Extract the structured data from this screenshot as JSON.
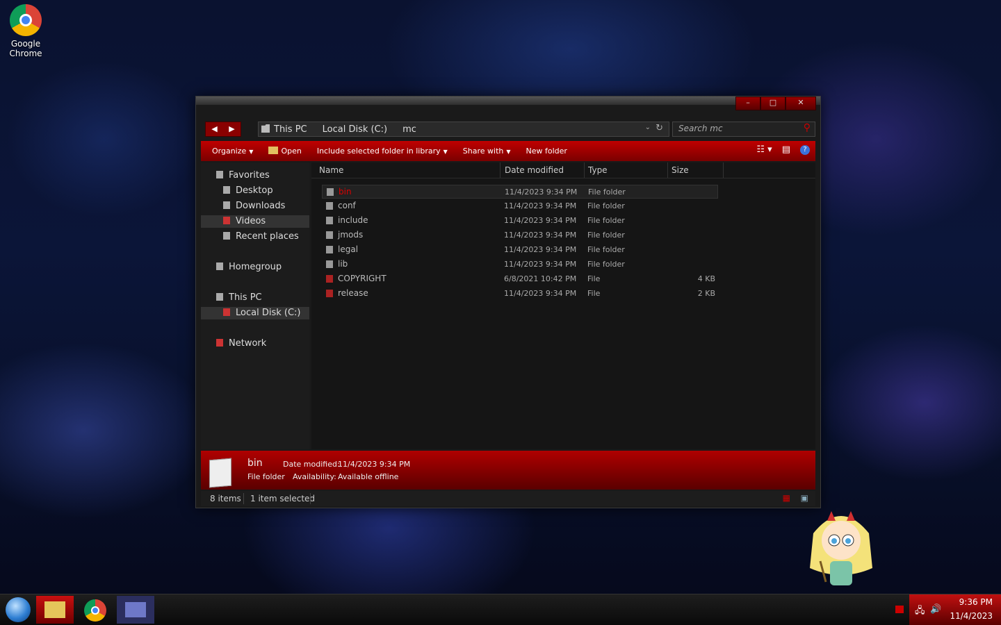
{
  "desktop": {
    "icon_label": "Google Chrome"
  },
  "window": {
    "controls": {
      "minimize": "–",
      "maximize": "□",
      "close": "✕"
    },
    "nav": {
      "back": "◀",
      "forward": "▶"
    },
    "breadcrumb": [
      "This PC",
      "Local Disk (C:)",
      "mc"
    ],
    "search_placeholder": "Search mc",
    "toolbar": {
      "organize": "Organize",
      "open": "Open",
      "include": "Include selected folder in library",
      "share": "Share with",
      "new_folder": "New folder"
    },
    "nav_pane": {
      "favorites": "Favorites",
      "desktop": "Desktop",
      "downloads": "Downloads",
      "videos": "Videos",
      "recent": "Recent places",
      "homegroup": "Homegroup",
      "this_pc": "This PC",
      "local_disk": "Local Disk (C:)",
      "network": "Network"
    },
    "columns": {
      "name": "Name",
      "date": "Date modified",
      "type": "Type",
      "size": "Size"
    },
    "files": [
      {
        "name": "bin",
        "date": "11/4/2023 9:34 PM",
        "type": "File folder",
        "size": ""
      },
      {
        "name": "conf",
        "date": "11/4/2023 9:34 PM",
        "type": "File folder",
        "size": ""
      },
      {
        "name": "include",
        "date": "11/4/2023 9:34 PM",
        "type": "File folder",
        "size": ""
      },
      {
        "name": "jmods",
        "date": "11/4/2023 9:34 PM",
        "type": "File folder",
        "size": ""
      },
      {
        "name": "legal",
        "date": "11/4/2023 9:34 PM",
        "type": "File folder",
        "size": ""
      },
      {
        "name": "lib",
        "date": "11/4/2023 9:34 PM",
        "type": "File folder",
        "size": ""
      },
      {
        "name": "COPYRIGHT",
        "date": "6/8/2021 10:42 PM",
        "type": "File",
        "size": "4 KB"
      },
      {
        "name": "release",
        "date": "11/4/2023 9:34 PM",
        "type": "File",
        "size": "2 KB"
      }
    ],
    "details": {
      "name": "bin",
      "type": "File folder",
      "date_label": "Date modified:",
      "date_value": "11/4/2023 9:34 PM",
      "avail_label": "Availability:",
      "avail_value": "Available offline"
    },
    "status": {
      "items": "8 items",
      "selected": "1 item selected"
    }
  },
  "taskbar": {
    "time": "9:36 PM",
    "date": "11/4/2023"
  }
}
